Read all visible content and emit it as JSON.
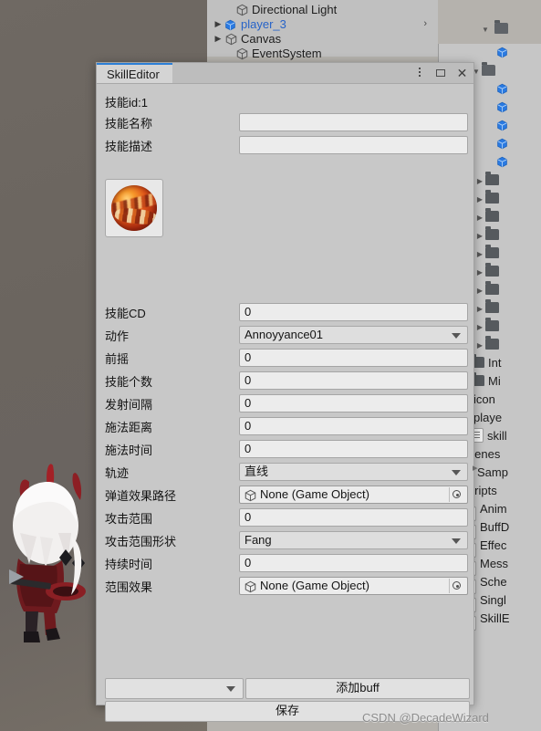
{
  "window": {
    "tab_title": "SkillEditor",
    "controls": {
      "menu": "⋮",
      "maximize": "maximize-icon",
      "close": "✕"
    },
    "skill_id_line": "技能id:1"
  },
  "form": {
    "rows": [
      {
        "label": "技能名称",
        "type": "text",
        "value": ""
      },
      {
        "label": "技能描述",
        "type": "text",
        "value": ""
      },
      {
        "label": "技能CD",
        "type": "text",
        "value": "0"
      },
      {
        "label": "动作",
        "type": "popup",
        "value": "Annoyyance01"
      },
      {
        "label": "前摇",
        "type": "text",
        "value": "0"
      },
      {
        "label": "技能个数",
        "type": "text",
        "value": "0"
      },
      {
        "label": "发射间隔",
        "type": "text",
        "value": "0"
      },
      {
        "label": "施法距离",
        "type": "text",
        "value": "0"
      },
      {
        "label": "施法时间",
        "type": "text",
        "value": "0"
      },
      {
        "label": "轨迹",
        "type": "popup",
        "value": "直线"
      },
      {
        "label": "弹道效果路径",
        "type": "object",
        "value": "None (Game Object)"
      },
      {
        "label": "攻击范围",
        "type": "text",
        "value": "0"
      },
      {
        "label": "攻击范围形状",
        "type": "popup",
        "value": "Fang"
      },
      {
        "label": "持续时间",
        "type": "text",
        "value": "0"
      },
      {
        "label": "范围效果",
        "type": "object",
        "value": "None (Game Object)"
      }
    ]
  },
  "footer": {
    "buff_select_value": "",
    "add_buff_label": "添加buff",
    "save_label": "保存"
  },
  "hierarchy": {
    "items": [
      {
        "label": "Directional Light",
        "indent": 16,
        "twisty": "",
        "selected": false,
        "has_arrow": false
      },
      {
        "label": "player_3",
        "indent": 4,
        "twisty": "▶",
        "selected": true,
        "has_arrow": true,
        "arrow": "›"
      },
      {
        "label": "Canvas",
        "indent": 4,
        "twisty": "▶",
        "selected": false,
        "has_arrow": false
      },
      {
        "label": "EventSystem",
        "indent": 16,
        "twisty": "",
        "selected": false,
        "has_arrow": false
      }
    ]
  },
  "project": {
    "items": [
      {
        "label": "",
        "type": "prefab",
        "indent": 64,
        "twisty": ""
      },
      {
        "label": "",
        "type": "folder-open",
        "indent": 48,
        "twisty": "▼"
      },
      {
        "label": "",
        "type": "prefab",
        "indent": 64,
        "twisty": ""
      },
      {
        "label": "",
        "type": "prefab",
        "indent": 64,
        "twisty": ""
      },
      {
        "label": "",
        "type": "prefab",
        "indent": 64,
        "twisty": ""
      },
      {
        "label": "",
        "type": "prefab",
        "indent": 64,
        "twisty": ""
      },
      {
        "label": "",
        "type": "prefab",
        "indent": 64,
        "twisty": ""
      },
      {
        "label": "",
        "type": "folder",
        "indent": 52,
        "twisty": "▶"
      },
      {
        "label": "",
        "type": "folder",
        "indent": 52,
        "twisty": "▶"
      },
      {
        "label": "",
        "type": "folder",
        "indent": 52,
        "twisty": "▶"
      },
      {
        "label": "",
        "type": "folder",
        "indent": 52,
        "twisty": "▶"
      },
      {
        "label": "",
        "type": "folder",
        "indent": 52,
        "twisty": "▶"
      },
      {
        "label": "",
        "type": "folder",
        "indent": 52,
        "twisty": "▶"
      },
      {
        "label": "",
        "type": "folder",
        "indent": 52,
        "twisty": "▶"
      },
      {
        "label": "",
        "type": "folder",
        "indent": 52,
        "twisty": "▶"
      },
      {
        "label": "",
        "type": "folder",
        "indent": 52,
        "twisty": "▶"
      },
      {
        "label": "",
        "type": "folder",
        "indent": 52,
        "twisty": "▶"
      },
      {
        "label": "Int",
        "type": "folder",
        "indent": 36,
        "twisty": "▶"
      },
      {
        "label": "Mi",
        "type": "folder",
        "indent": 36,
        "twisty": "▶"
      },
      {
        "label": "icon",
        "type": "folder",
        "indent": 20,
        "twisty": "▶"
      },
      {
        "label": "playe",
        "type": "folder",
        "indent": 20,
        "twisty": "▶"
      },
      {
        "label": "skill",
        "type": "text-asset",
        "indent": 34,
        "twisty": ""
      },
      {
        "label": "Scenes",
        "type": "folder-open",
        "indent": 6,
        "twisty": ""
      },
      {
        "label": "Samp",
        "type": "scene",
        "indent": 26,
        "twisty": ""
      },
      {
        "label": "Scripts",
        "type": "folder-open",
        "indent": 6,
        "twisty": ""
      },
      {
        "label": "Anim",
        "type": "script",
        "indent": 26,
        "twisty": ""
      },
      {
        "label": "BuffD",
        "type": "script",
        "indent": 26,
        "twisty": ""
      },
      {
        "label": "Effec",
        "type": "script",
        "indent": 26,
        "twisty": ""
      },
      {
        "label": "Mess",
        "type": "script",
        "indent": 26,
        "twisty": ""
      },
      {
        "label": "Sche",
        "type": "script",
        "indent": 26,
        "twisty": ""
      },
      {
        "label": "Singl",
        "type": "script",
        "indent": 26,
        "twisty": ""
      },
      {
        "label": "SkillE",
        "type": "script",
        "indent": 26,
        "twisty": ""
      }
    ]
  },
  "watermark": {
    "text": "CSDN @DecadeWizard"
  },
  "colors": {
    "window_bg": "#c8c8c8",
    "tab_accent": "#2c7fd6",
    "field_bg": "#ececec",
    "popup_bg": "#dedede",
    "game_view_bg": "#6b655f",
    "selected_text": "#2763c8"
  }
}
